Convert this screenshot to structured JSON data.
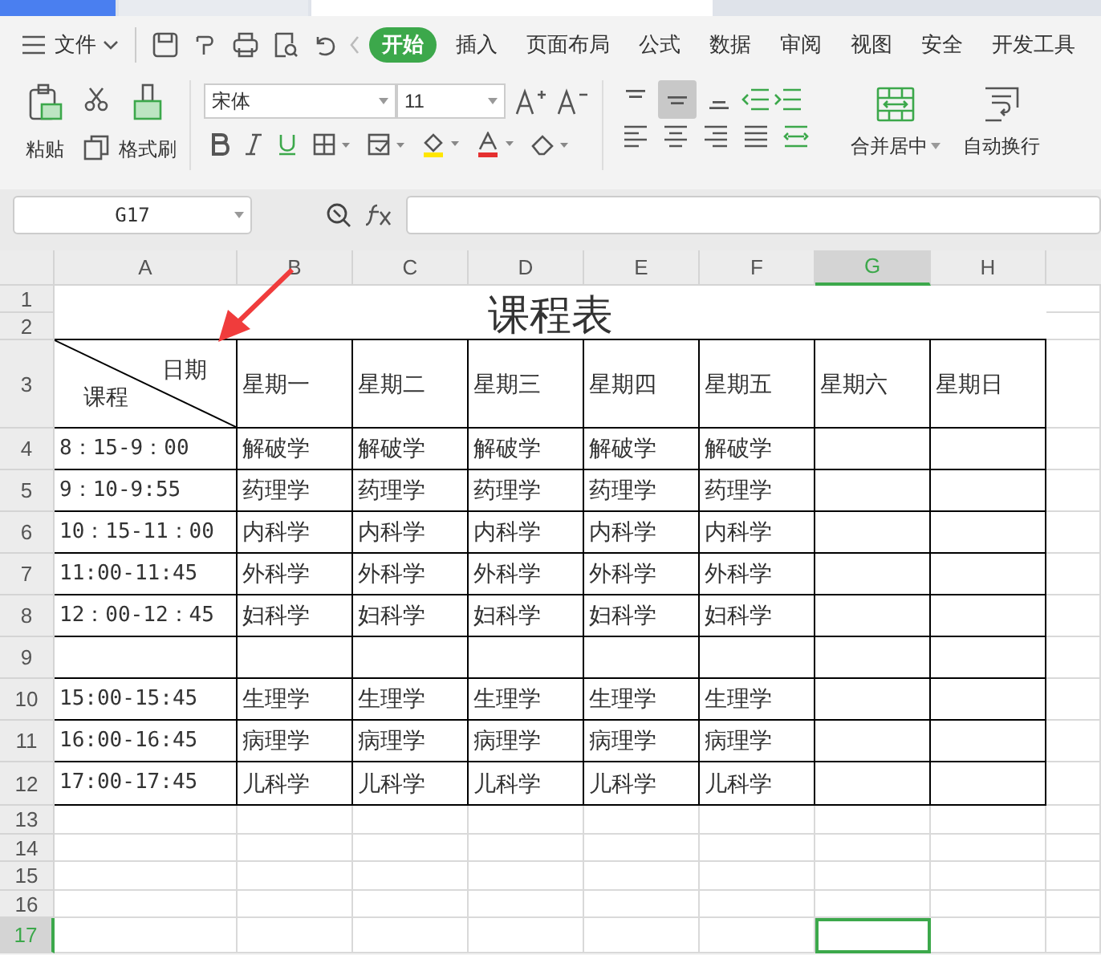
{
  "menu": {
    "file": "文件",
    "tabs": [
      {
        "label": "开始",
        "selected": true
      },
      {
        "label": "插入",
        "selected": false
      },
      {
        "label": "页面布局",
        "selected": false
      },
      {
        "label": "公式",
        "selected": false
      },
      {
        "label": "数据",
        "selected": false
      },
      {
        "label": "审阅",
        "selected": false
      },
      {
        "label": "视图",
        "selected": false
      },
      {
        "label": "安全",
        "selected": false
      },
      {
        "label": "开发工具",
        "selected": false
      }
    ]
  },
  "ribbon": {
    "paste": "粘贴",
    "format_painter": "格式刷",
    "font": "宋体",
    "size": "11",
    "merge": "合并居中",
    "wrap": "自动换行",
    "vertical_align": [
      {
        "selected": false
      },
      {
        "selected": true
      },
      {
        "selected": false
      }
    ]
  },
  "formula_bar": {
    "name_box": "G17"
  },
  "columns": [
    {
      "label": "A",
      "selected": false
    },
    {
      "label": "B",
      "selected": false
    },
    {
      "label": "C",
      "selected": false
    },
    {
      "label": "D",
      "selected": false
    },
    {
      "label": "E",
      "selected": false
    },
    {
      "label": "F",
      "selected": false
    },
    {
      "label": "G",
      "selected": true
    },
    {
      "label": "H",
      "selected": false
    }
  ],
  "row_numbers": [
    {
      "label": "1",
      "selected": false
    },
    {
      "label": "2",
      "selected": false
    },
    {
      "label": "3",
      "selected": false
    },
    {
      "label": "4",
      "selected": false
    },
    {
      "label": "5",
      "selected": false
    },
    {
      "label": "6",
      "selected": false
    },
    {
      "label": "7",
      "selected": false
    },
    {
      "label": "8",
      "selected": false
    },
    {
      "label": "9",
      "selected": false
    },
    {
      "label": "10",
      "selected": false
    },
    {
      "label": "11",
      "selected": false
    },
    {
      "label": "12",
      "selected": false
    },
    {
      "label": "13",
      "selected": false
    },
    {
      "label": "14",
      "selected": false
    },
    {
      "label": "15",
      "selected": false
    },
    {
      "label": "16",
      "selected": false
    },
    {
      "label": "17",
      "selected": true
    }
  ],
  "sheet": {
    "title": "课程表",
    "corner_top": "日期",
    "corner_bottom": "课程",
    "days": [
      "星期一",
      "星期二",
      "星期三",
      "星期四",
      "星期五",
      "星期六",
      "星期日"
    ],
    "rows": [
      {
        "time": "8：15-9：00",
        "courses": [
          "解破学",
          "解破学",
          "解破学",
          "解破学",
          "解破学"
        ]
      },
      {
        "time": "9：10-9:55",
        "courses": [
          "药理学",
          "药理学",
          "药理学",
          "药理学",
          "药理学"
        ]
      },
      {
        "time": "10：15-11：00",
        "courses": [
          "内科学",
          "内科学",
          "内科学",
          "内科学",
          "内科学"
        ]
      },
      {
        "time": "11:00-11:45",
        "courses": [
          "外科学",
          "外科学",
          "外科学",
          "外科学",
          "外科学"
        ]
      },
      {
        "time": "12：00-12：45",
        "courses": [
          "妇科学",
          "妇科学",
          "妇科学",
          "妇科学",
          "妇科学"
        ]
      },
      {
        "courses": []
      },
      {
        "time": "15:00-15:45",
        "courses": [
          "生理学",
          "生理学",
          "生理学",
          "生理学",
          "生理学"
        ]
      },
      {
        "time": "16:00-16:45",
        "courses": [
          "病理学",
          "病理学",
          "病理学",
          "病理学",
          "病理学"
        ]
      },
      {
        "time": "17:00-17:45",
        "courses": [
          "儿科学",
          "儿科学",
          "儿科学",
          "儿科学",
          "儿科学"
        ]
      }
    ]
  }
}
